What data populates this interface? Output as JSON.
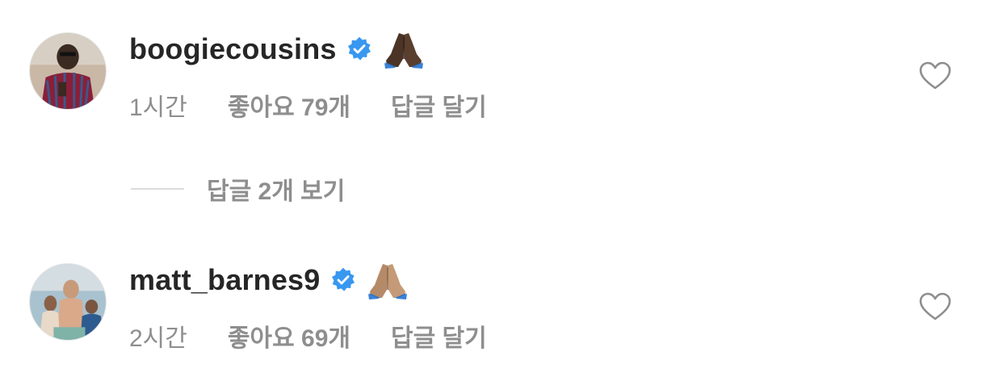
{
  "comments": [
    {
      "username": "boogiecousins",
      "verified": true,
      "text_emoji": "folded-hands-dark",
      "time": "1시간",
      "likes": "좋아요 79개",
      "reply": "답글 달기"
    },
    {
      "username": "matt_barnes9",
      "verified": true,
      "text_emoji": "folded-hands-medium",
      "time": "2시간",
      "likes": "좋아요 69개",
      "reply": "답글 달기"
    }
  ],
  "view_replies": "답글 2개 보기",
  "colors": {
    "text_primary": "#262626",
    "text_secondary": "#8e8e8e",
    "verified_blue": "#3897f0",
    "divider": "#dbdbdb"
  }
}
